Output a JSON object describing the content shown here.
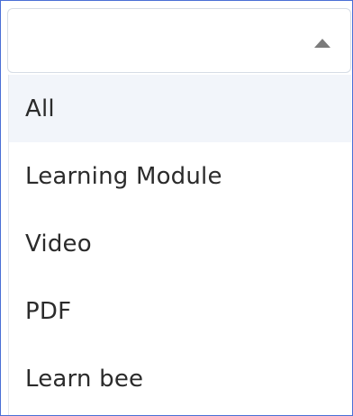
{
  "select": {
    "value": "",
    "icon": "caret-up-icon"
  },
  "menu": {
    "items": [
      {
        "label": "All",
        "active": true
      },
      {
        "label": "Learning Module"
      },
      {
        "label": "Video"
      },
      {
        "label": "PDF"
      },
      {
        "label": "Learn bee"
      }
    ]
  }
}
